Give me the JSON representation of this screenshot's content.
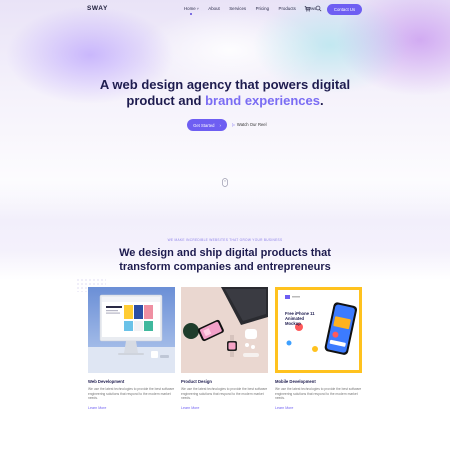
{
  "header": {
    "logo": "SWAY",
    "nav": [
      "Home",
      "About",
      "Services",
      "Pricing",
      "Products",
      "News"
    ],
    "nav_active_chevron": "˅",
    "contact_label": "Contact Us"
  },
  "hero": {
    "title_line1": "A web design agency that powers digital",
    "title_line2_part1": "product and ",
    "title_line2_accent": "brand experiences",
    "title_line2_end": ".",
    "cta_label": "Get Started",
    "cta_arrow": "›",
    "watch_label": "Watch Our Reel",
    "watch_icon": "▷"
  },
  "section": {
    "eyebrow": "WE MAKE INCREDIBLE WEBSITES THAT GROW YOUR BUSINESS",
    "title_line1": "We design and ship digital products that",
    "title_line2": "transform companies and entrepreneurs"
  },
  "cards": [
    {
      "title": "Web Development",
      "desc": "We use the latest technologies to provide the best software engineering solutions that respond to the modern market needs.",
      "link": "Learn More"
    },
    {
      "title": "Product Design",
      "desc": "We use the latest technologies to provide the best software engineering solutions that respond to the modern market needs.",
      "link": "Learn More"
    },
    {
      "title": "Mobile Development",
      "desc": "We use the latest technologies to provide the best software engineering solutions that respond to the modern market needs.",
      "link": "Learn More"
    }
  ],
  "mockup3": {
    "heading": "Free iPhone 11 Animated Mockup"
  },
  "colors": {
    "accent": "#6e5ef2",
    "heading": "#1e1c4f"
  }
}
